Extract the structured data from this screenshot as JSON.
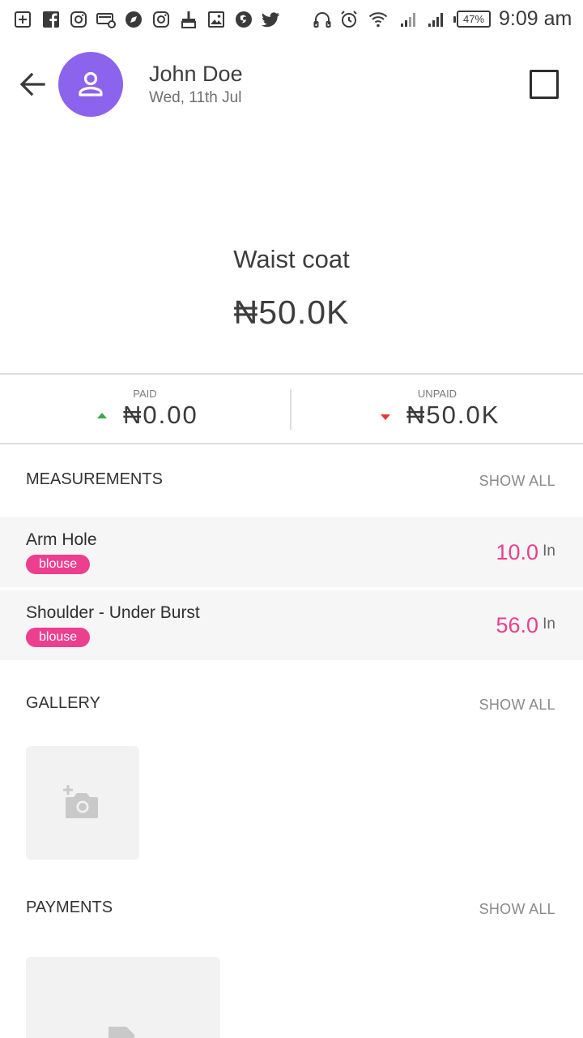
{
  "status_bar": {
    "time": "9:09 am",
    "battery": "47%"
  },
  "header": {
    "client_name": "John Doe",
    "date": "Wed, 11th Jul"
  },
  "job": {
    "title": "Waist coat",
    "price": "₦50.0K"
  },
  "payment_summary": {
    "paid_label": "PAID",
    "paid_value": "₦0.00",
    "unpaid_label": "UNPAID",
    "unpaid_value": "₦50.0K"
  },
  "measurements": {
    "title": "MEASUREMENTS",
    "show_all": "SHOW ALL",
    "items": [
      {
        "name": "Arm Hole",
        "tag": "blouse",
        "value": "10.0",
        "unit": "In"
      },
      {
        "name": "Shoulder - Under Burst",
        "tag": "blouse",
        "value": "56.0",
        "unit": "In"
      }
    ]
  },
  "gallery": {
    "title": "GALLERY",
    "show_all": "SHOW ALL"
  },
  "payments": {
    "title": "PAYMENTS",
    "show_all": "SHOW ALL"
  },
  "colors": {
    "avatar": "#8b63ec",
    "accent_pink": "#e8408c",
    "tag_bg": "#ec3f8e",
    "paid_arrow": "#3ea64a",
    "unpaid_arrow": "#e53935"
  },
  "icons": {
    "back": "arrow-left-icon",
    "avatar": "person-icon",
    "gallery_add": "add-photo-icon",
    "payment_add": "add-payment-icon"
  }
}
